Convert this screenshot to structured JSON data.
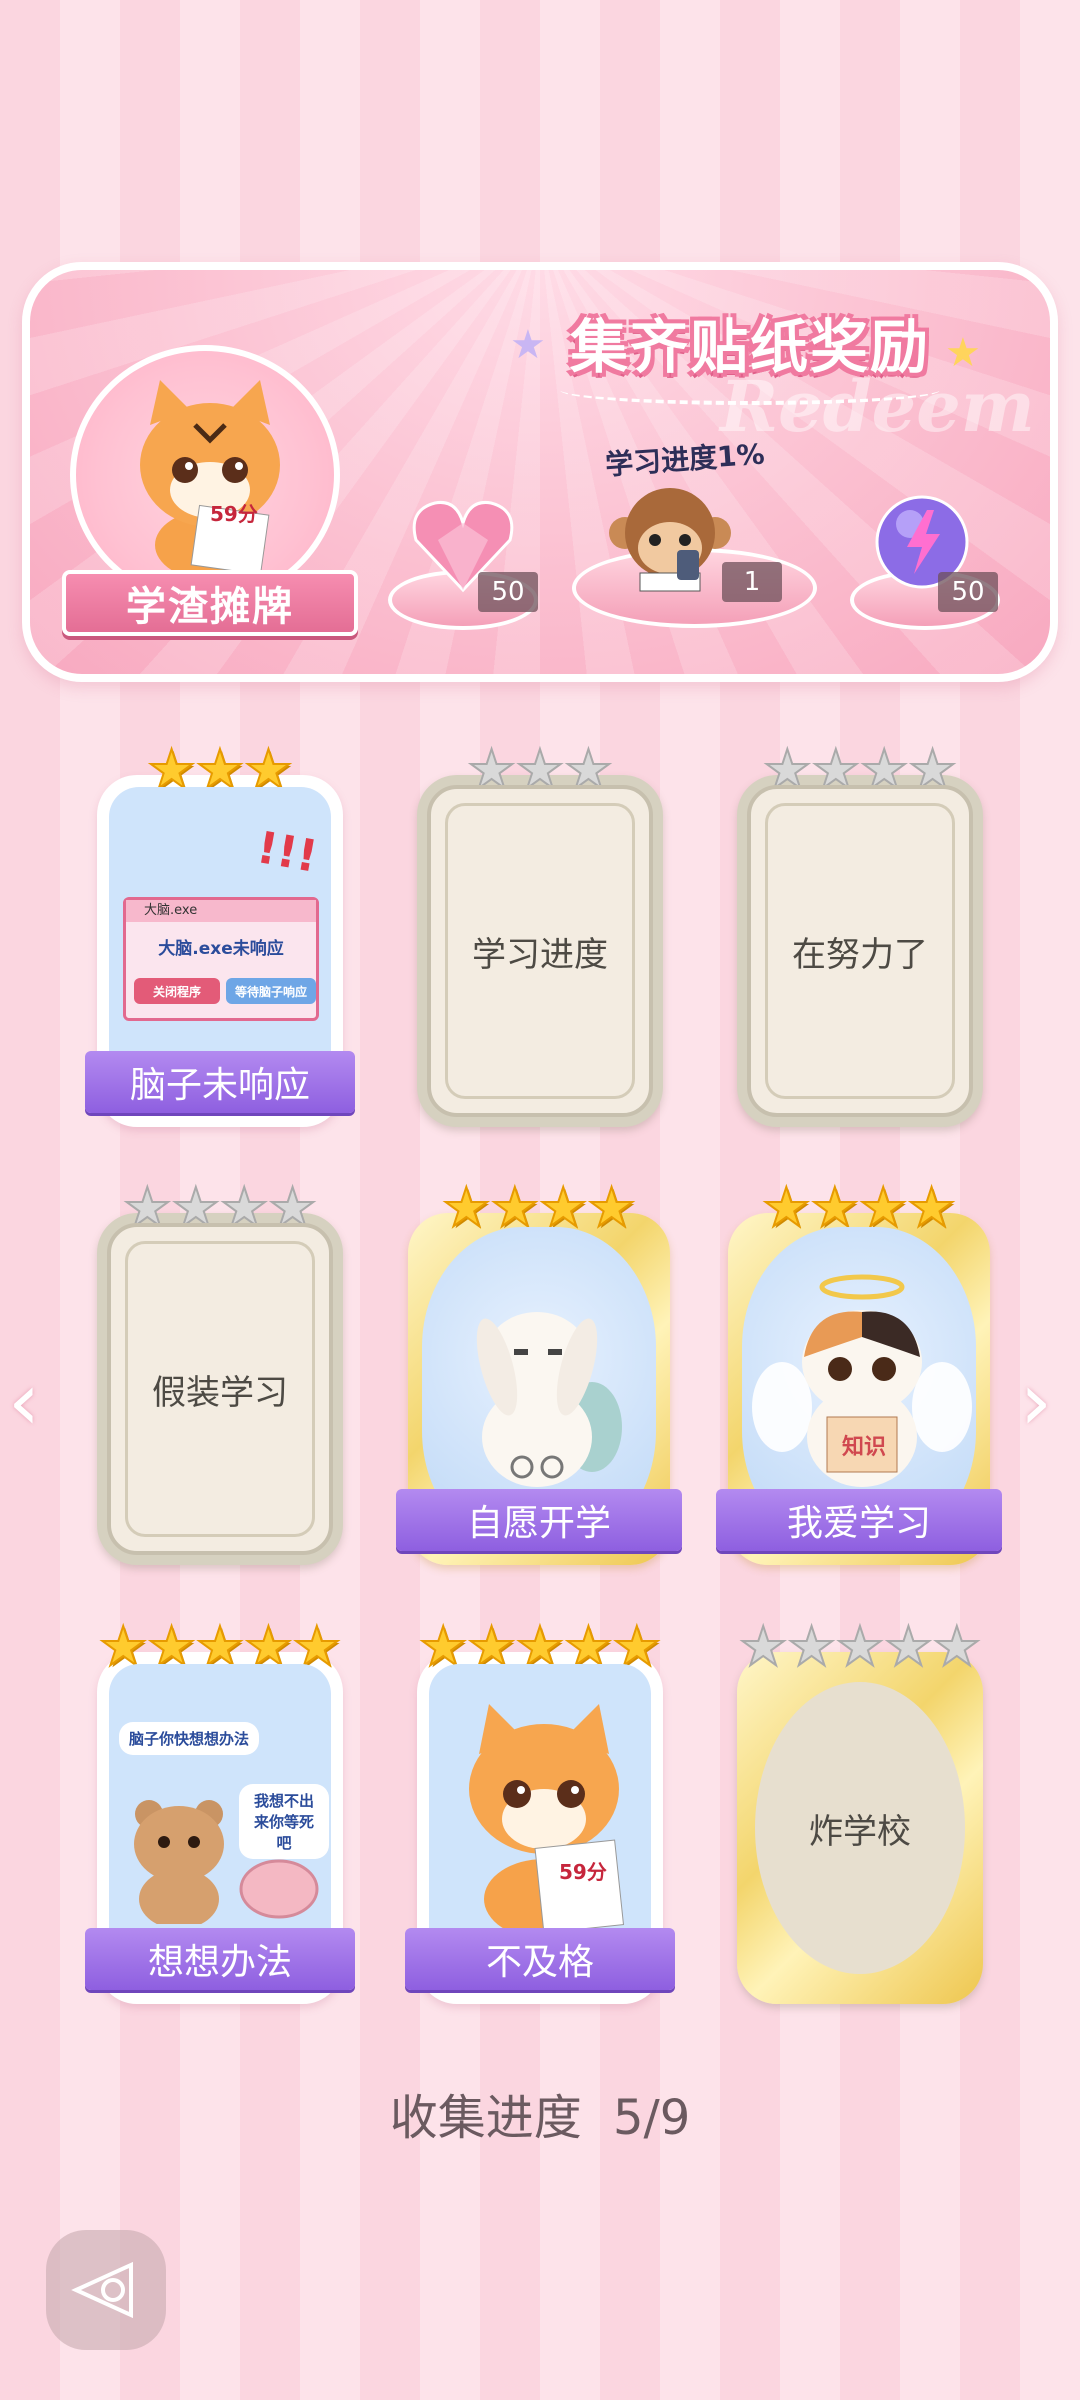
{
  "banner": {
    "title": "集齐贴纸奖励",
    "watermark": "Redeem",
    "avatar_label": "学渣摊牌",
    "avatar_paper_text": "59分",
    "progress_label": "学习进度1%",
    "rewards": [
      {
        "icon": "pink-heart-gem-icon",
        "count": "50"
      },
      {
        "icon": "monkey-reading-icon",
        "count": "1"
      },
      {
        "icon": "purple-lightning-orb-icon",
        "count": "50"
      }
    ]
  },
  "cards": [
    {
      "label": "脑子未响应",
      "stars_on": 3,
      "stars_total": 3,
      "state": "unlocked",
      "art": {
        "window_title": "大脑.exe",
        "message": "大脑.exe未响应",
        "btn_close": "关闭程序",
        "btn_wait": "等待脑子响应",
        "exclaim": "!!!"
      }
    },
    {
      "label": "学习进度",
      "stars_on": 0,
      "stars_total": 3,
      "state": "locked"
    },
    {
      "label": "在努力了",
      "stars_on": 0,
      "stars_total": 4,
      "state": "locked"
    },
    {
      "label": "假装学习",
      "stars_on": 0,
      "stars_total": 4,
      "state": "locked"
    },
    {
      "label": "自愿开学",
      "stars_on": 4,
      "stars_total": 4,
      "state": "unlocked-gold"
    },
    {
      "label": "我爱学习",
      "stars_on": 4,
      "stars_total": 4,
      "state": "unlocked-gold",
      "art": {
        "book_text": "知识"
      }
    },
    {
      "label": "想想办法",
      "stars_on": 5,
      "stars_total": 5,
      "state": "unlocked",
      "art": {
        "bubble1": "脑子你快想想办法",
        "bubble2": "我想不出来你等死吧"
      }
    },
    {
      "label": "不及格",
      "stars_on": 5,
      "stars_total": 5,
      "state": "unlocked",
      "art": {
        "paper_text": "59分"
      }
    },
    {
      "label": "炸学校",
      "stars_on": 0,
      "stars_total": 5,
      "state": "locked-gold"
    }
  ],
  "collection": {
    "label": "收集进度",
    "value": "5/9"
  },
  "nav": {
    "prev": "‹",
    "next": "›"
  }
}
